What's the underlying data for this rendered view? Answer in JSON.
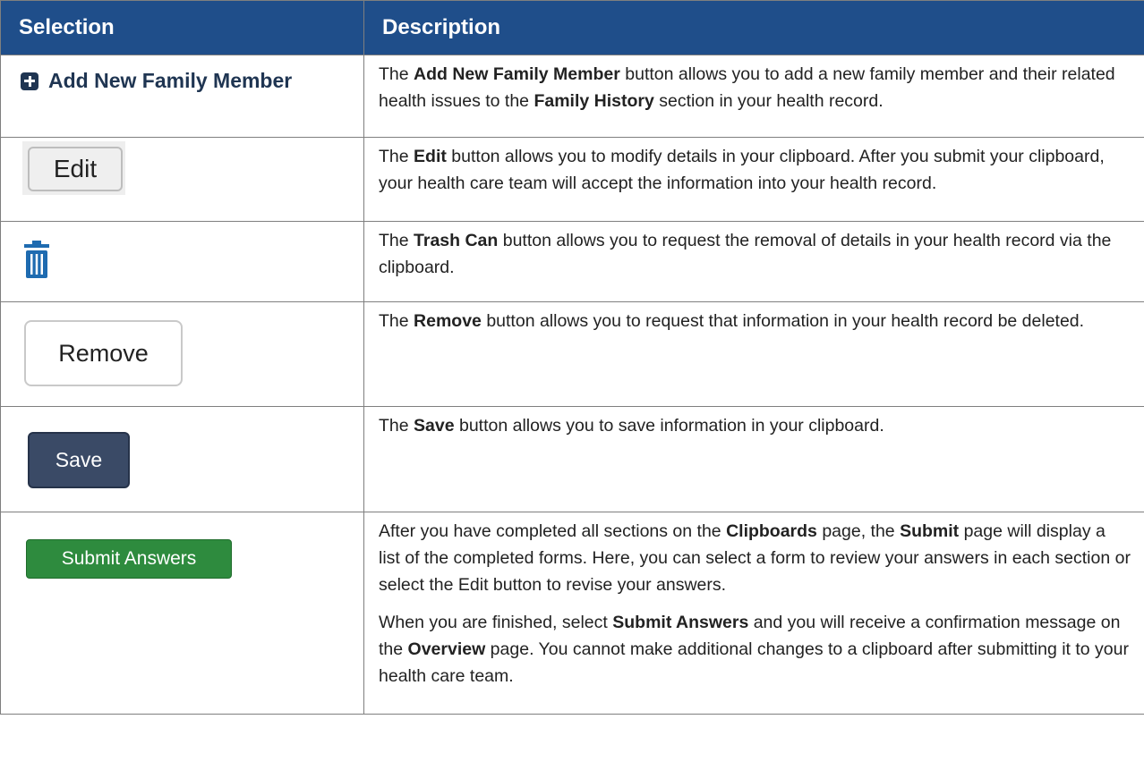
{
  "header": {
    "selection": "Selection",
    "description": "Description"
  },
  "rows": {
    "add": {
      "button_label": "Add New Family Member",
      "pre": "The ",
      "b1": "Add New Family Member",
      "mid1": " button allows you to add a new family member and their related health issues to the ",
      "b2": "Family History",
      "post": " section in your health record."
    },
    "edit": {
      "button_label": "Edit",
      "pre": "The ",
      "b1": "Edit",
      "post": " button allows you to modify details in your clipboard. After you submit your clipboard, your health care team will accept the information into your health record."
    },
    "trash": {
      "icon": "trash-can-icon",
      "pre": "The ",
      "b1": "Trash Can",
      "post": " button allows you to request the removal of details in your health record via the clipboard."
    },
    "remove": {
      "button_label": "Remove",
      "pre": "The ",
      "b1": "Remove",
      "post": " button allows you to request that information in your health record be deleted."
    },
    "save": {
      "button_label": "Save",
      "pre": "The ",
      "b1": "Save",
      "post": " button allows you to save information in your clipboard."
    },
    "submit": {
      "button_label": "Submit Answers",
      "p1_pre": "After you have completed all sections on the ",
      "p1_b1": "Clipboards",
      "p1_mid": " page, the ",
      "p1_b2": "Submit",
      "p1_post": " page will display a list of the completed forms. Here, you can select a form to review your answers in each section or select the Edit button to revise your answers.",
      "p2_pre": "When you are finished, select ",
      "p2_b1": "Submit Answers",
      "p2_mid": " and you will receive a confirmation message on the ",
      "p2_b2": "Overview",
      "p2_post": " page. You cannot make additional changes to a clipboard after submitting it to your health care team."
    }
  },
  "colors": {
    "header_bg": "#1f4e8a",
    "save_bg": "#3a4a66",
    "submit_bg": "#2e8b3e",
    "trash_icon": "#1e6bb0",
    "add_icon": "#1f3552"
  }
}
